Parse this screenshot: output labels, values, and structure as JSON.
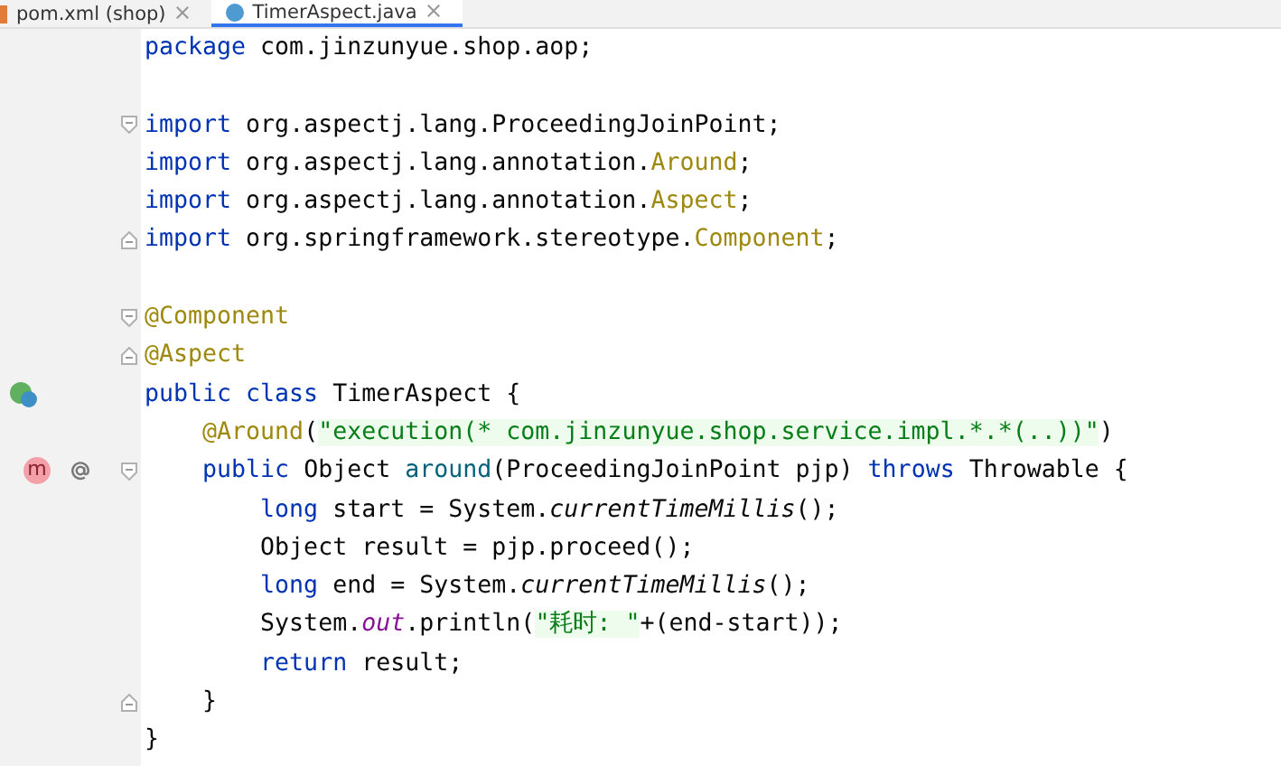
{
  "tabs": [
    {
      "label": "pom.xml (shop)",
      "selected": false
    },
    {
      "label": "TimerAspect.java",
      "selected": true
    }
  ],
  "lines": [
    {
      "kind": "code",
      "fold_start": false,
      "fold_end": false,
      "tokens": [
        {
          "text": "package ",
          "kind": "kw"
        },
        {
          "text": "com.jinzunyue.shop.aop;",
          "kind": "plain"
        }
      ]
    },
    {
      "kind": "code",
      "fold_start": false,
      "fold_end": false
    },
    {
      "kind": "code",
      "fold_start": true,
      "fold_end": false,
      "tokens": [
        {
          "text": "import ",
          "kind": "kw"
        },
        {
          "text": "org.aspectj.lang.ProceedingJoinPoint;",
          "kind": "plain"
        }
      ]
    },
    {
      "kind": "code",
      "fold_start": false,
      "fold_end": false,
      "tokens": [
        {
          "text": "import ",
          "kind": "kw"
        },
        {
          "text": "org.aspectj.lang.annotation.",
          "kind": "plain"
        },
        {
          "text": "Around",
          "kind": "ann"
        },
        {
          "text": ";",
          "kind": "plain"
        }
      ]
    },
    {
      "kind": "code",
      "fold_start": false,
      "fold_end": false,
      "tokens": [
        {
          "text": "import ",
          "kind": "kw"
        },
        {
          "text": "org.aspectj.lang.annotation.",
          "kind": "plain"
        },
        {
          "text": "Aspect",
          "kind": "ann"
        },
        {
          "text": ";",
          "kind": "plain"
        }
      ]
    },
    {
      "kind": "code",
      "fold_start": false,
      "fold_end": true,
      "tokens": [
        {
          "text": "import ",
          "kind": "kw"
        },
        {
          "text": "org.springframework.stereotype.",
          "kind": "plain"
        },
        {
          "text": "Component",
          "kind": "ann"
        },
        {
          "text": ";",
          "kind": "plain"
        }
      ]
    },
    {
      "kind": "code",
      "fold_start": false,
      "fold_end": false
    },
    {
      "kind": "code",
      "fold_start": true,
      "fold_end": false,
      "tokens": [
        {
          "text": "@Component",
          "kind": "ann"
        }
      ]
    },
    {
      "kind": "code",
      "fold_start": false,
      "fold_end": true,
      "tokens": [
        {
          "text": "@Aspect",
          "kind": "ann"
        }
      ]
    },
    {
      "kind": "class",
      "fold_start": false,
      "fold_end": false,
      "tokens": [
        {
          "text": "public class ",
          "kind": "kw"
        },
        {
          "text": "TimerAspect {",
          "kind": "plain"
        }
      ]
    },
    {
      "kind": "code",
      "fold_start": false,
      "fold_end": false,
      "tokens": [
        {
          "text": "    @Around",
          "kind": "ann"
        },
        {
          "text": "(",
          "kind": "plain"
        },
        {
          "text": "\"execution(* com.jinzunyue.shop.service.impl.*.*(..))\"",
          "kind": "str"
        },
        {
          "text": ")",
          "kind": "plain"
        }
      ]
    },
    {
      "kind": "method",
      "marker_letter": "m",
      "fold_start": true,
      "fold_end": false,
      "tokens": [
        {
          "text": "    public ",
          "kind": "kw"
        },
        {
          "text": "Object ",
          "kind": "plain"
        },
        {
          "text": "around",
          "kind": "method"
        },
        {
          "text": "(ProceedingJoinPoint pjp) ",
          "kind": "plain"
        },
        {
          "text": "throws ",
          "kind": "kw"
        },
        {
          "text": "Throwable {",
          "kind": "plain"
        }
      ]
    },
    {
      "kind": "code",
      "fold_start": false,
      "fold_end": false,
      "tokens": [
        {
          "text": "        long ",
          "kind": "kw"
        },
        {
          "text": "start = System.",
          "kind": "plain"
        },
        {
          "text": "currentTimeMillis",
          "kind": "static"
        },
        {
          "text": "();",
          "kind": "plain"
        }
      ]
    },
    {
      "kind": "code",
      "fold_start": false,
      "fold_end": false,
      "tokens": [
        {
          "text": "        Object result = pjp.proceed();",
          "kind": "plain"
        }
      ]
    },
    {
      "kind": "code",
      "fold_start": false,
      "fold_end": false,
      "tokens": [
        {
          "text": "        long ",
          "kind": "kw"
        },
        {
          "text": "end = System.",
          "kind": "plain"
        },
        {
          "text": "currentTimeMillis",
          "kind": "static"
        },
        {
          "text": "();",
          "kind": "plain"
        }
      ]
    },
    {
      "kind": "code",
      "fold_start": false,
      "fold_end": false,
      "tokens": [
        {
          "text": "        System.",
          "kind": "plain"
        },
        {
          "text": "out",
          "kind": "field"
        },
        {
          "text": ".println(",
          "kind": "plain"
        },
        {
          "text": "\"耗时: \"",
          "kind": "str"
        },
        {
          "text": "+(end-start));",
          "kind": "plain"
        }
      ]
    },
    {
      "kind": "code",
      "fold_start": false,
      "fold_end": false,
      "tokens": [
        {
          "text": "        return ",
          "kind": "kw"
        },
        {
          "text": "result;",
          "kind": "plain"
        }
      ]
    },
    {
      "kind": "code",
      "fold_start": false,
      "fold_end": true,
      "tokens": [
        {
          "text": "    }",
          "kind": "plain"
        }
      ]
    },
    {
      "kind": "code",
      "fold_start": false,
      "fold_end": false,
      "tokens": [
        {
          "text": "}",
          "kind": "plain"
        }
      ]
    }
  ]
}
